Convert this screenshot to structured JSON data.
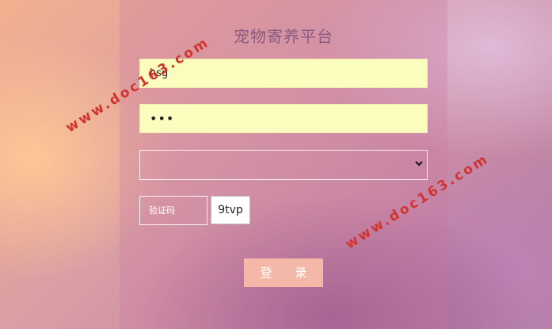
{
  "header": {
    "title": "宠物寄养平台"
  },
  "form": {
    "username": "hsg",
    "password_mask": "•••",
    "role_selected": "",
    "captcha_placeholder": "验证码",
    "captcha_code": "9tvp",
    "login_label": "登 录"
  },
  "watermarks": [
    "www.doc163.com",
    "www.doc163.com"
  ],
  "colors": {
    "field_bg": "#fbfdbf",
    "login_bg": "#f4b8a8",
    "title_color": "#8a5a80",
    "watermark": "#d0342f"
  }
}
